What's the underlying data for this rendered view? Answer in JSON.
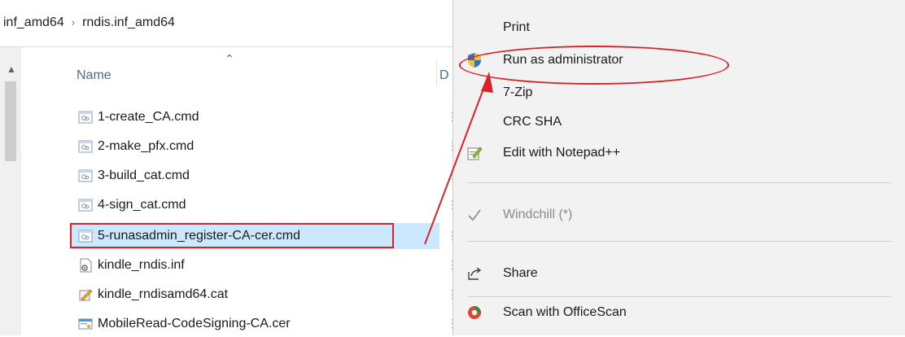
{
  "breadcrumb": [
    "inf_amd64",
    "rndis.inf_amd64"
  ],
  "breadcrumb_separator": "›",
  "list_header": {
    "name_label": "Name",
    "second_label": "D"
  },
  "files": [
    {
      "name": "1-create_CA.cmd",
      "icon": "cmd-file-icon"
    },
    {
      "name": "2-make_pfx.cmd",
      "icon": "cmd-file-icon"
    },
    {
      "name": "3-build_cat.cmd",
      "icon": "cmd-file-icon"
    },
    {
      "name": "4-sign_cat.cmd",
      "icon": "cmd-file-icon"
    },
    {
      "name": "5-runasadmin_register-CA-cer.cmd",
      "icon": "cmd-file-icon",
      "selected": true
    },
    {
      "name": "kindle_rndis.inf",
      "icon": "inf-file-icon"
    },
    {
      "name": "kindle_rndisamd64.cat",
      "icon": "catalog-file-icon"
    },
    {
      "name": "MobileRead-CodeSigning-CA.cer",
      "icon": "certificate-file-icon"
    }
  ],
  "context_menu": {
    "items": [
      {
        "label": "Print",
        "icon": ""
      },
      {
        "label": "Run as administrator",
        "icon": "uac-shield-icon"
      },
      {
        "label": "7-Zip",
        "icon": ""
      },
      {
        "label": "CRC SHA",
        "icon": ""
      },
      {
        "label": "Edit with Notepad++",
        "icon": "notepad-plus-plus-icon"
      },
      {
        "label": "Windchill (*)",
        "icon": "checkmark-icon",
        "disabled": true
      },
      {
        "label": "Share",
        "icon": "share-icon"
      },
      {
        "label": "Scan with OfficeScan",
        "icon": "officescan-icon"
      }
    ]
  },
  "colors": {
    "annotation_red": "#d8232a",
    "selection_blue": "#cce8ff",
    "menu_background": "#f2f2f2"
  }
}
